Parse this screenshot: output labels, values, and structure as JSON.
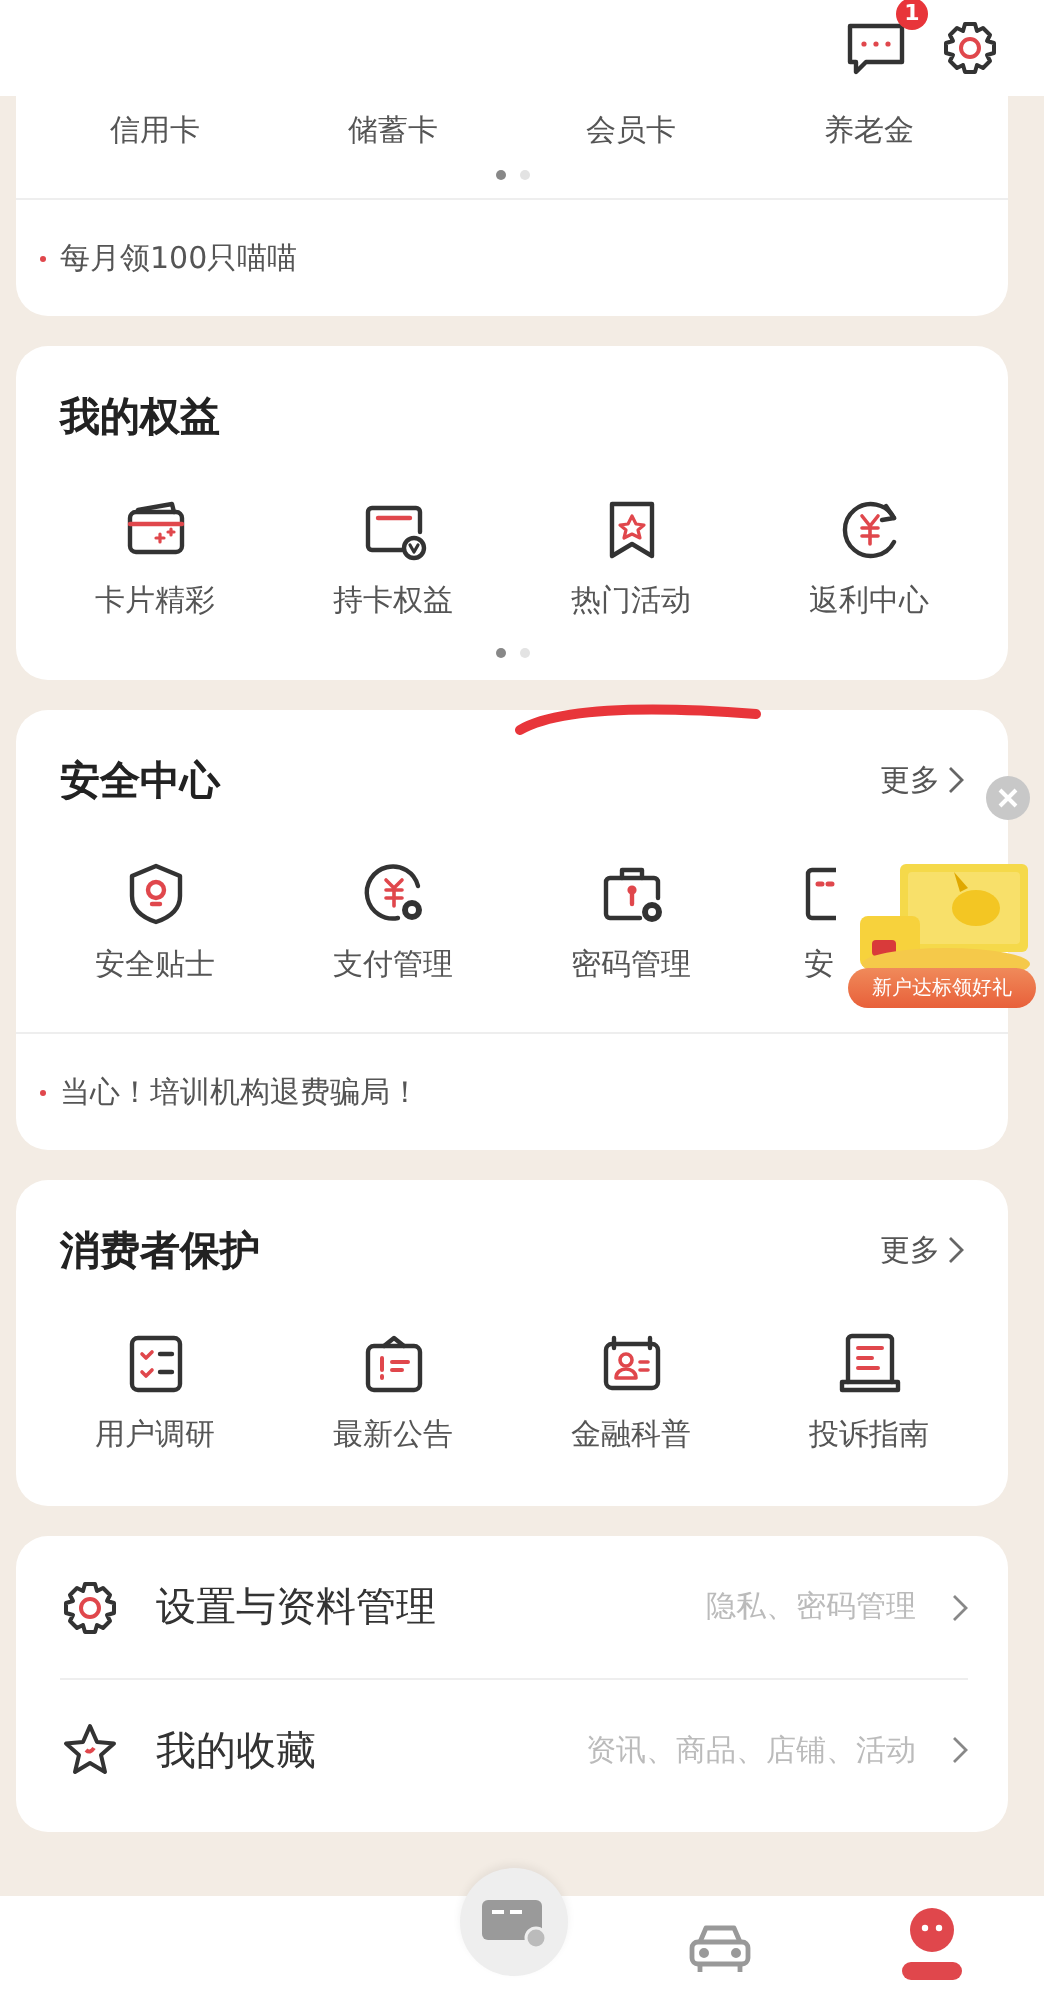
{
  "top_bar": {
    "message_badge": "1"
  },
  "cards_section": {
    "items": [
      "信用卡",
      "储蓄卡",
      "会员卡",
      "养老金"
    ],
    "pager": [
      {
        "selected": true
      },
      {
        "selected": false
      }
    ],
    "notice": "每月领100只喵喵"
  },
  "rights": {
    "title": "我的权益",
    "items": [
      "卡片精彩",
      "持卡权益",
      "热门活动",
      "返利中心"
    ],
    "pager": [
      {
        "selected": true
      },
      {
        "selected": false
      }
    ]
  },
  "security": {
    "title": "安全中心",
    "more": "更多",
    "items": [
      "安全贴士",
      "支付管理",
      "密码管理",
      "安"
    ],
    "notice": "当心！培训机构退费骗局！"
  },
  "promo": {
    "label": "新户达标领好礼"
  },
  "consumer": {
    "title": "消费者保护",
    "more": "更多",
    "items": [
      "用户调研",
      "最新公告",
      "金融科普",
      "投诉指南"
    ]
  },
  "menu": [
    {
      "label": "设置与资料管理",
      "hint": "隐私、密码管理"
    },
    {
      "label": "我的收藏",
      "hint": "资讯、商品、店铺、活动"
    }
  ],
  "tabbar": {
    "tabs": [
      {
        "selected": false
      },
      {
        "selected": false
      },
      {
        "selected": true
      }
    ]
  }
}
